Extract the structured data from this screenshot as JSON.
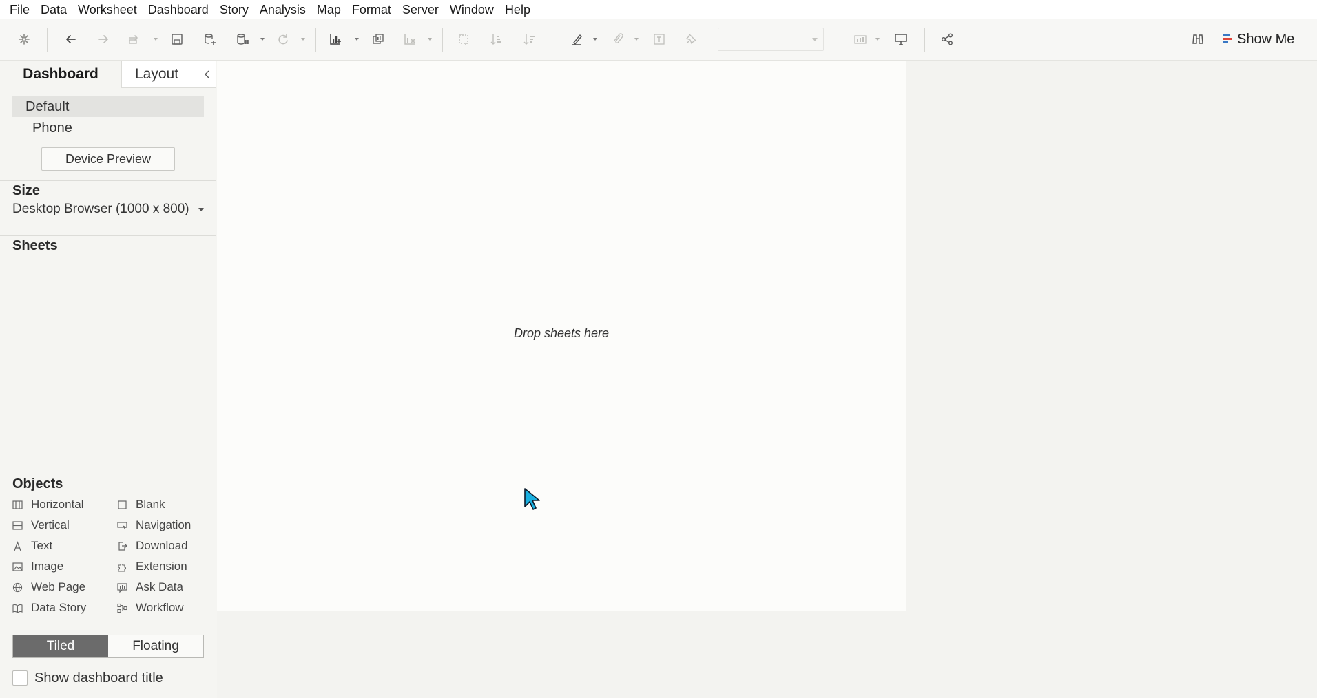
{
  "menu": [
    "File",
    "Data",
    "Worksheet",
    "Dashboard",
    "Story",
    "Analysis",
    "Map",
    "Format",
    "Server",
    "Window",
    "Help"
  ],
  "toolbar": {
    "fit_value": "",
    "show_me_label": "Show Me",
    "icons": [
      "tableau-logo-icon",
      "undo-icon",
      "redo-icon",
      "paste-icon",
      "save-icon",
      "new-data-source-icon",
      "pause-updates-icon",
      "refresh-icon",
      "new-worksheet-icon",
      "duplicate-icon",
      "clear-icon",
      "swap-icon",
      "sort-ascending-icon",
      "sort-descending-icon",
      "highlight-icon",
      "group-icon",
      "labels-icon",
      "pin-icon",
      "fit-select",
      "chart-icon",
      "presentation-icon",
      "share-icon",
      "binoculars-icon"
    ]
  },
  "panel": {
    "tabs": {
      "dashboard": "Dashboard",
      "layout": "Layout"
    },
    "devices": {
      "default": "Default",
      "phone": "Phone"
    },
    "device_preview_label": "Device Preview",
    "size": {
      "title": "Size",
      "value": "Desktop Browser (1000 x 800)"
    },
    "sheets_title": "Sheets",
    "objects": {
      "title": "Objects",
      "left": [
        {
          "label": "Horizontal",
          "icon": "horizontal-icon"
        },
        {
          "label": "Vertical",
          "icon": "vertical-icon"
        },
        {
          "label": "Text",
          "icon": "text-icon"
        },
        {
          "label": "Image",
          "icon": "image-icon"
        },
        {
          "label": "Web Page",
          "icon": "globe-icon"
        },
        {
          "label": "Data Story",
          "icon": "book-icon"
        }
      ],
      "right": [
        {
          "label": "Blank",
          "icon": "blank-icon"
        },
        {
          "label": "Navigation",
          "icon": "navigation-icon"
        },
        {
          "label": "Download",
          "icon": "download-icon"
        },
        {
          "label": "Extension",
          "icon": "puzzle-icon"
        },
        {
          "label": "Ask Data",
          "icon": "ask-data-icon"
        },
        {
          "label": "Workflow",
          "icon": "workflow-icon"
        }
      ]
    },
    "mode": {
      "tiled": "Tiled",
      "floating": "Floating",
      "selected": "Tiled"
    },
    "show_title_label": "Show dashboard title",
    "show_title_checked": false
  },
  "canvas": {
    "drop_text": "Drop sheets here"
  },
  "colors": {
    "accent_red": "#e0453a",
    "accent_blue": "#3a78c4",
    "cursor": "#1ab0e0"
  }
}
